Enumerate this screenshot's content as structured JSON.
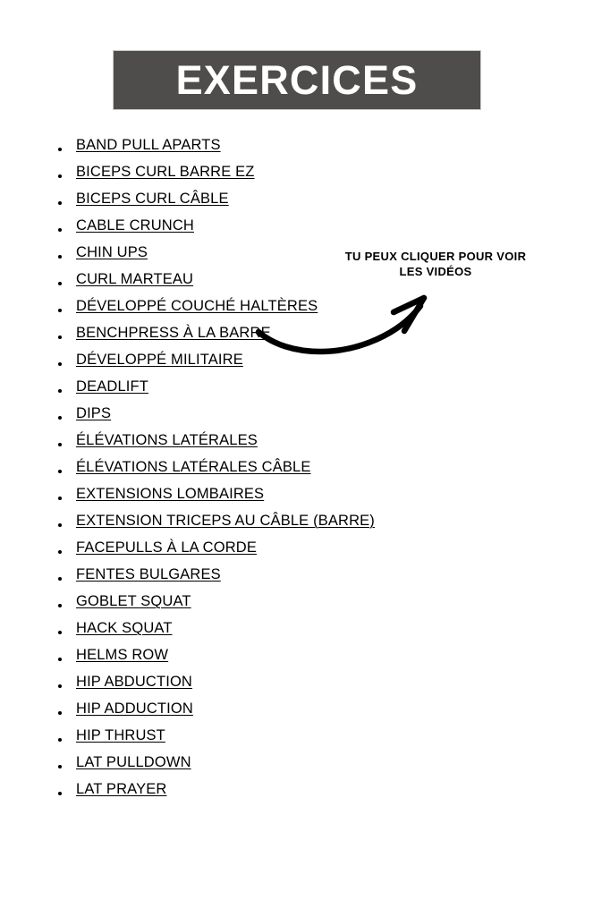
{
  "header": {
    "title": "EXERCICES",
    "background_color": "#4f4d4b",
    "text_color": "#ffffff"
  },
  "annotation": {
    "line1": "TU PEUX CLIQUER POUR VOIR",
    "line2": "LES VIDÉOS",
    "full_text": "TU PEUX CLIQUER POUR VOIR LES VIDÉOS",
    "arrow": "curved-arrow-up-right"
  },
  "exercise_list": {
    "items": [
      {
        "label": "BAND PULL APARTS"
      },
      {
        "label": "BICEPS CURL BARRE EZ"
      },
      {
        "label": "BICEPS CURL CÂBLE"
      },
      {
        "label": "CABLE CRUNCH"
      },
      {
        "label": "CHIN UPS"
      },
      {
        "label": "CURL MARTEAU"
      },
      {
        "label": "DÉVELOPPÉ COUCHÉ HALTÈRES"
      },
      {
        "label": "BENCHPRESS À LA BARRE"
      },
      {
        "label": "DÉVELOPPÉ MILITAIRE"
      },
      {
        "label": "DEADLIFT"
      },
      {
        "label": "DIPS"
      },
      {
        "label": "ÉLÉVATIONS LATÉRALES"
      },
      {
        "label": "ÉLÉVATIONS LATÉRALES CÂBLE"
      },
      {
        "label": "EXTENSIONS LOMBAIRES"
      },
      {
        "label": "EXTENSION TRICEPS AU CÂBLE (BARRE)"
      },
      {
        "label": "FACEPULLS À LA CORDE"
      },
      {
        "label": "FENTES BULGARES"
      },
      {
        "label": "GOBLET SQUAT"
      },
      {
        "label": "HACK SQUAT"
      },
      {
        "label": "HELMS ROW"
      },
      {
        "label": "HIP ABDUCTION"
      },
      {
        "label": "HIP ADDUCTION"
      },
      {
        "label": "HIP THRUST"
      },
      {
        "label": "LAT PULLDOWN"
      },
      {
        "label": "LAT PRAYER"
      }
    ]
  },
  "colors": {
    "page_background": "#ffffff",
    "text": "#000000",
    "banner": "#4f4d4b",
    "banner_border": "#c9c9c9"
  }
}
